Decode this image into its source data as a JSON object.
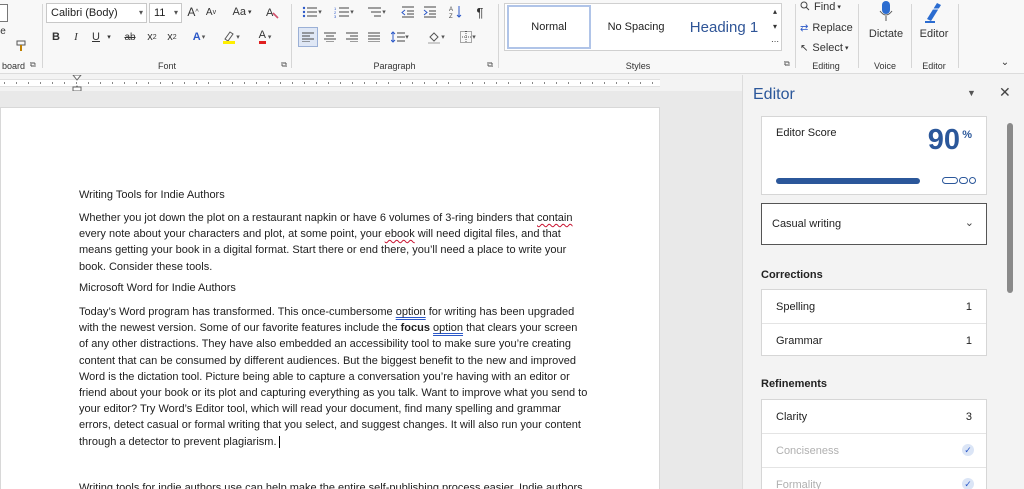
{
  "ribbon": {
    "clipboard_label": "board",
    "font_name": "Calibri (Body)",
    "font_size": "11",
    "font_group_label": "Font",
    "paragraph_group_label": "Paragraph",
    "styles_group_label": "Styles",
    "styles": [
      "Normal",
      "No Spacing",
      "Heading 1"
    ],
    "editing": {
      "find": "Find",
      "replace": "Replace",
      "select": "Select",
      "label": "Editing"
    },
    "voice": {
      "dictate": "Dictate",
      "label": "Voice"
    },
    "editor_group": {
      "editor": "Editor",
      "label": "Editor"
    },
    "case_label": "Aa",
    "font_grow": "A",
    "font_shrink": "A",
    "bold": "B",
    "italic": "I",
    "underline": "U",
    "strike": "ab",
    "subscript": "x",
    "superscript": "x",
    "text_effects": "A",
    "font_color": "A",
    "pilcrow": "¶"
  },
  "document": {
    "heading1": "Writing Tools for Indie Authors",
    "para1": [
      "Whether you jot down the plot on a restaurant napkin or have 6 volumes of 3-ring binders that ",
      "contain",
      " every note about your characters and plot, at some point, your ",
      "ebook",
      " will need digital files, and that means getting your book in a digital format. Start there or end there, you’ll need a place to write your book. Consider these tools."
    ],
    "heading2": "Microsoft Word for Indie Authors",
    "para2": [
      " Today’s Word program has transformed. This once-cumbersome ",
      "option",
      " for writing has been upgraded with the newest version. Some of our favorite features include the ",
      "focus",
      " ",
      "option",
      " that clears your screen of any other distractions. They have also embedded an accessibility tool to make sure you’re creating content that can be consumed by different audiences. But the biggest benefit to the new and improved Word is the dictation tool. Picture being able to capture a conversation you’re having with an editor or friend about your book or its plot and capturing everything as you talk. Want to improve what you send to your editor? Try Word’s Editor tool, which will read your document, find many spelling and grammar errors, detect casual or formal writing that you select, and suggest changes. It will also run your content through a detector to prevent plagiarism."
    ],
    "para3": "Writing tools for indie authors use can help make the entire self-publishing process easier. Indie authors"
  },
  "editor": {
    "title": "Editor",
    "score_label": "Editor Score",
    "score_value": "90",
    "score_unit": "%",
    "score_progress": 0.9,
    "writing_style": "Casual writing",
    "corrections_heading": "Corrections",
    "corrections": [
      {
        "label": "Spelling",
        "count": "1"
      },
      {
        "label": "Grammar",
        "count": "1"
      }
    ],
    "refinements_heading": "Refinements",
    "refinements": [
      {
        "label": "Clarity",
        "count": "3"
      },
      {
        "label": "Conciseness",
        "count": ""
      },
      {
        "label": "Formality",
        "count": ""
      }
    ],
    "accent_color": "#2b579a"
  }
}
